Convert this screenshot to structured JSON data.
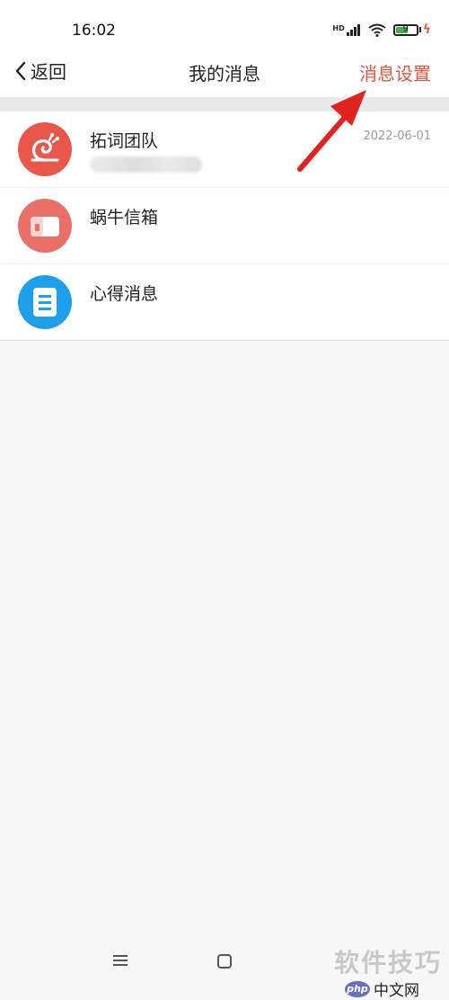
{
  "status_bar": {
    "time": "16:02",
    "network": "HD",
    "battery": "9"
  },
  "navbar": {
    "back_label": "返回",
    "title": "我的消息",
    "settings_label": "消息设置"
  },
  "messages": [
    {
      "title": "拓词团队",
      "date": "2022-06-01",
      "icon": "snail-icon"
    },
    {
      "title": "蜗牛信箱",
      "date": "",
      "icon": "mailbox-icon"
    },
    {
      "title": "心得消息",
      "date": "",
      "icon": "document-icon"
    }
  ],
  "watermark": {
    "line1": "软件技巧",
    "brand_badge": "php",
    "brand_text": "中文网"
  },
  "colors": {
    "accent": "#e0553f",
    "snail_avatar": "#e8574a",
    "mailbox_avatar": "#ea6f66",
    "notes_avatar": "#1e9fea"
  },
  "annotation": {
    "arrow_color": "#e0231f",
    "points_to": "消息设置"
  }
}
